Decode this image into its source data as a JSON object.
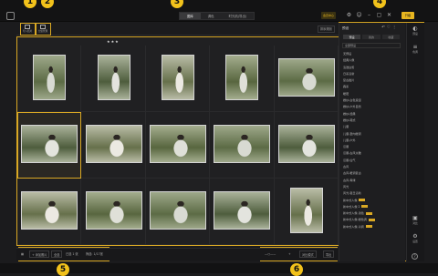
{
  "titlebar": {
    "tabs": [
      {
        "label": "图库",
        "active": true
      },
      {
        "label": "调色",
        "active": false
      },
      {
        "label": "时光机(导出)",
        "active": false
      }
    ],
    "vip_label": "会员中心",
    "upgrade_label": "升级",
    "icons": [
      "settings-icon",
      "user-icon",
      "minimize-icon",
      "close-icon"
    ]
  },
  "toolbar": {
    "import_label": "导入照片",
    "manage_label": "分组管理",
    "rating_stars": "★★★",
    "sort_label": "排序规则"
  },
  "grid": {
    "rows": [
      {
        "items": [
          {
            "orient": "portrait"
          },
          {
            "orient": "portrait"
          },
          {
            "orient": "portrait"
          },
          {
            "orient": "portrait"
          },
          {
            "orient": "landscape"
          }
        ]
      },
      {
        "items": [
          {
            "orient": "landscape",
            "selected": true
          },
          {
            "orient": "landscape"
          },
          {
            "orient": "landscape"
          },
          {
            "orient": "landscape"
          },
          {
            "orient": "landscape"
          }
        ]
      },
      {
        "items": [
          {
            "orient": "landscape"
          },
          {
            "orient": "landscape"
          },
          {
            "orient": "landscape"
          },
          {
            "orient": "landscape"
          },
          {
            "orient": "portrait"
          }
        ]
      }
    ]
  },
  "bottombar": {
    "add_label": "+ 添加照片",
    "sel_label": "全选",
    "count_label": "已选 1 张",
    "filter_label": "筛选: 1/17张",
    "compare_label": "对比模式",
    "export_label": "导出"
  },
  "right_panel": {
    "title": "预设",
    "tabs": [
      {
        "label": "预设",
        "active": true
      },
      {
        "label": "我的",
        "active": false
      },
      {
        "label": "收藏",
        "active": false
      }
    ],
    "select_label": "全部预设",
    "items": [
      {
        "label": "无预设",
        "tag": false
      },
      {
        "label": "经典人像",
        "tag": false
      },
      {
        "label": "清透白皙",
        "tag": false
      },
      {
        "label": "日系清新",
        "tag": false
      },
      {
        "label": "复古胶片",
        "tag": false
      },
      {
        "label": "森系",
        "tag": false
      },
      {
        "label": "暖阳",
        "tag": false
      },
      {
        "label": "婚纱-白色浪漫",
        "tag": false
      },
      {
        "label": "婚纱-户外自然",
        "tag": false
      },
      {
        "label": "婚纱-经典",
        "tag": false
      },
      {
        "label": "婚纱-韩式",
        "tag": false
      },
      {
        "label": "儿童",
        "tag": false
      },
      {
        "label": "儿童-室内暖调",
        "tag": false
      },
      {
        "label": "儿童-户外",
        "tag": false
      },
      {
        "label": "汉服",
        "tag": false
      },
      {
        "label": "汉服-古风淡雅",
        "tag": false
      },
      {
        "label": "汉服-仙气",
        "tag": false
      },
      {
        "label": "古风",
        "tag": false
      },
      {
        "label": "古风-暖调复古",
        "tag": false
      },
      {
        "label": "古风-青绿",
        "tag": false
      },
      {
        "label": "风光",
        "tag": false
      },
      {
        "label": "风光-夏日清新",
        "tag": false
      },
      {
        "label": "新中式人像",
        "tag": true
      },
      {
        "label": "新中式人像 2",
        "tag": true
      },
      {
        "label": "新中式人像-浅色",
        "tag": true
      },
      {
        "label": "新中式人像-暖色调",
        "tag": true
      },
      {
        "label": "新中式人像-冷调",
        "tag": true
      }
    ]
  },
  "side_strip": [
    {
      "label": "预设",
      "icon": "palette-icon"
    },
    {
      "label": "色调",
      "icon": "sliders-icon"
    },
    {
      "label": "对比",
      "icon": "compare-icon"
    },
    {
      "label": "设置",
      "icon": "gear-icon"
    }
  ],
  "callouts": [
    "1",
    "2",
    "3",
    "4",
    "5",
    "6"
  ],
  "colors": {
    "accent": "#d9a824",
    "bg": "#1b1b1d"
  }
}
